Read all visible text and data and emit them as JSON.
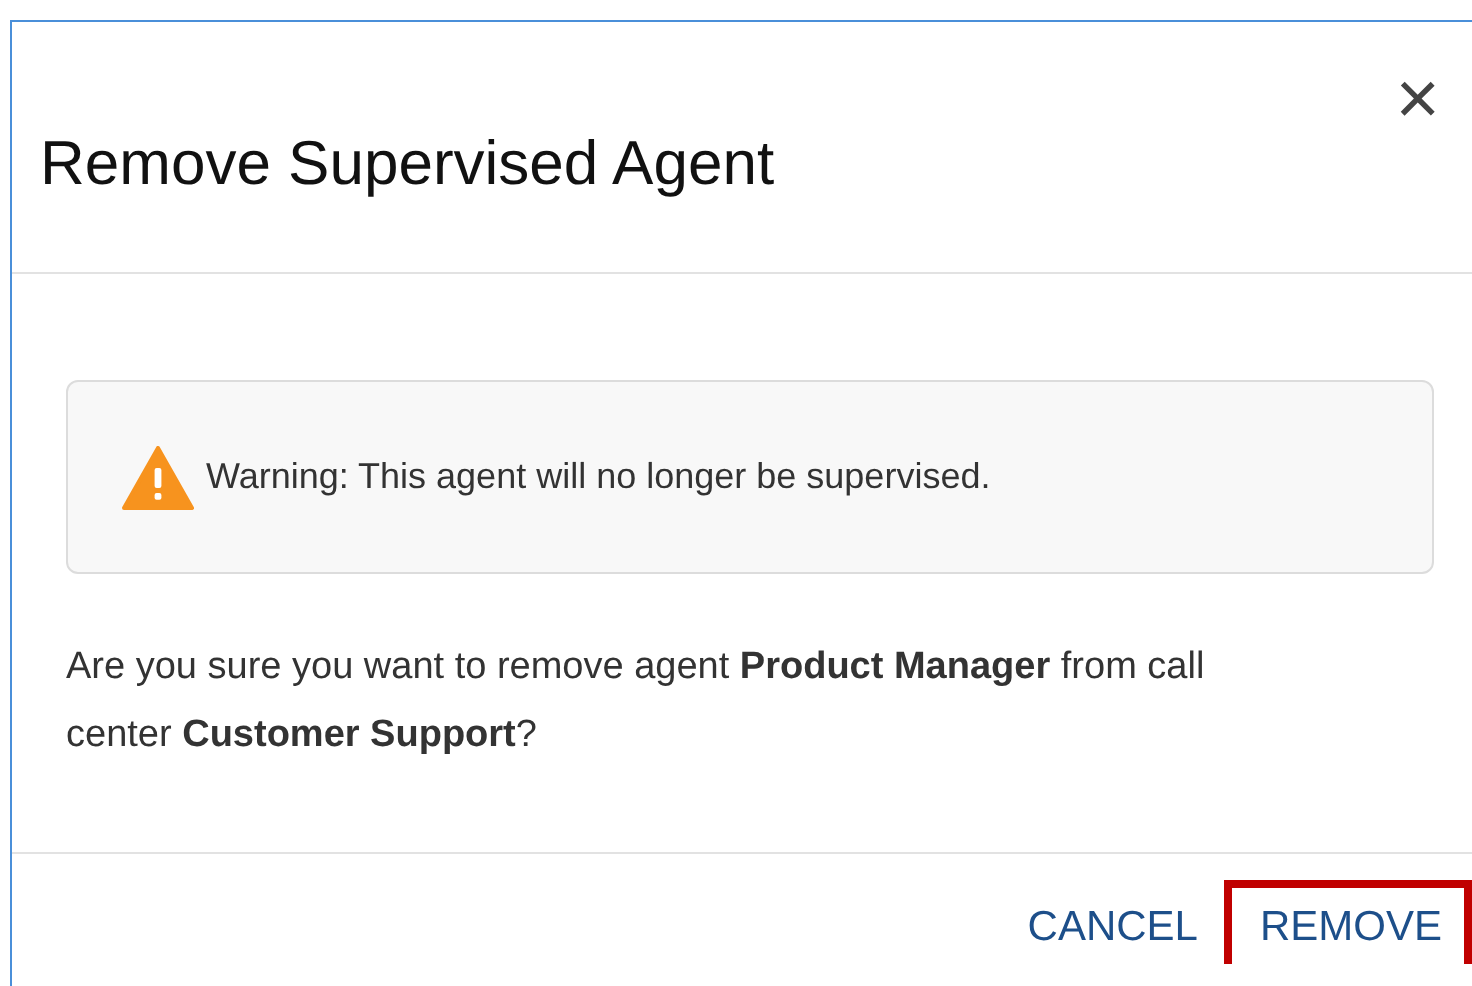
{
  "dialog": {
    "title": "Remove Supervised Agent",
    "close": "×",
    "warning": "Warning: This agent will no longer be supervised.",
    "message": "Are you sure you want to remove agent **Product Manager** from call center **Customer Support**?",
    "buttons": [
      {
        "label": "CANCEL",
        "highlighted": false
      },
      {
        "label": "REMOVE",
        "highlighted": true
      }
    ]
  }
}
